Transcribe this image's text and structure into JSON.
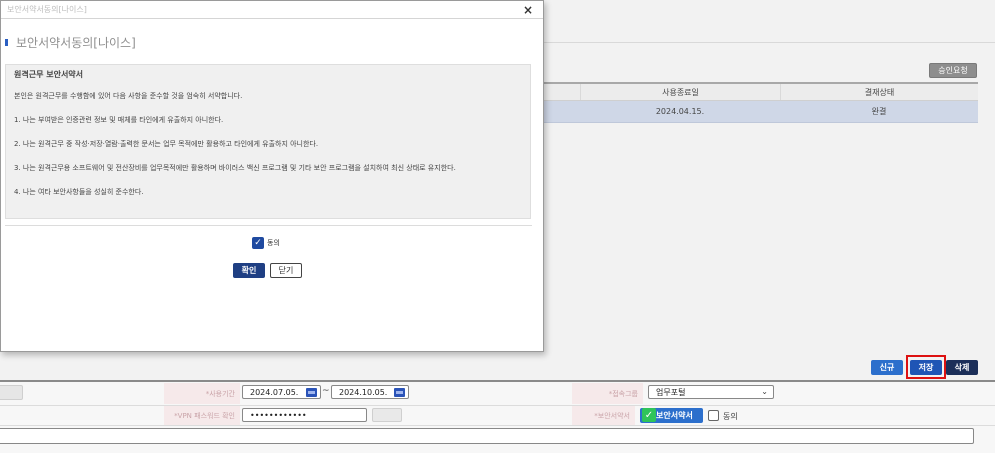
{
  "modal": {
    "window_title": "보안서약서동의[나이스]",
    "close_symbol": "×",
    "heading": "보안서약서동의[나이스]",
    "terms_title": "원격근무 보안서약서",
    "terms_lines": [
      "본인은 원격근무를 수행함에 있어 다음 사항을 준수할 것을 엄숙히 서약합니다.",
      "1. 나는 부여받은 인증관련 정보 및 매체를 타인에게 유출하지 아니한다.",
      "2. 나는 원격근무 중 작성·저장·열람·출력한 문서는 업무 목적에만 활용하고 타인에게 유출하지 아니한다.",
      "3. 나는 원격근무용 소프트웨어 및 전산장비를 업무목적에만 활용하며 바이러스 백신 프로그램 및 기타 보안 프로그램을 설치하여 최신 상태로 유지한다.",
      "4. 나는 여타 보안사항들을 성실히 준수한다."
    ],
    "agree_label": "동의",
    "agree_checked": true,
    "confirm_label": "확인",
    "close_label": "닫기"
  },
  "background": {
    "approve_request_label": "승인요청",
    "table": {
      "headers": {
        "end_date": "사용종료일",
        "status": "결재상태"
      },
      "rows": [
        {
          "end_date": "2024.04.15.",
          "status": "완결"
        }
      ]
    },
    "actions": {
      "new_label": "신규",
      "save_label": "저장",
      "delete_label": "삭제"
    },
    "form": {
      "period_label": "*사용기간",
      "period_start": "2024.07.05.",
      "period_separator": "~",
      "period_end": "2024.10.05.",
      "access_group_label": "*접속그룹",
      "access_group_value": "업무포털",
      "password_label": "*VPN 패스워드 확인",
      "password_value": "••••••••••••",
      "security_label": "*보안서약서",
      "security_button_label": "보안서약서",
      "security_agree_label": "동의"
    }
  },
  "colors": {
    "accent_blue": "#2c6fcc",
    "dark_navy": "#1f3f83",
    "highlight_red": "#d11111",
    "check_green": "#2fc45a",
    "selected_row": "#cfd7e7"
  }
}
